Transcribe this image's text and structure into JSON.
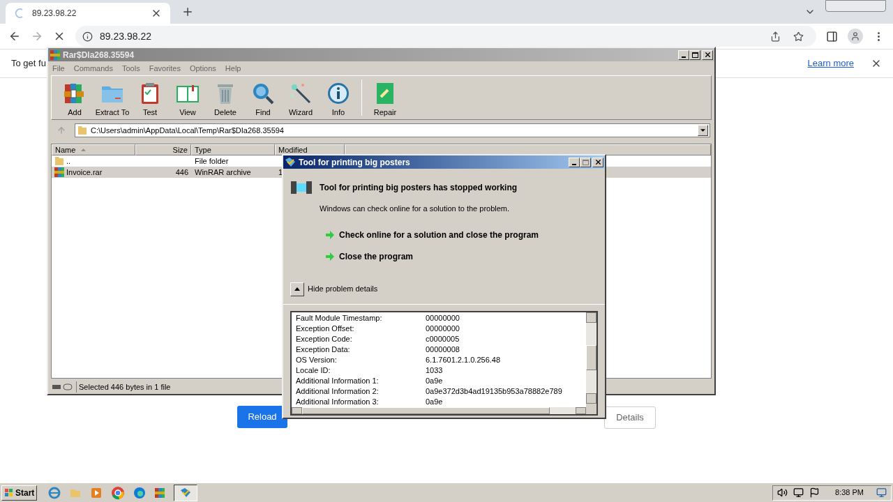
{
  "browser": {
    "tab": {
      "title": "89.23.98.22"
    },
    "address": "89.23.98.22",
    "infobar": {
      "text": "To get fu",
      "link": "Learn more"
    },
    "buttons": {
      "reload": "Reload",
      "details": "Details"
    }
  },
  "winrar": {
    "title": "Rar$DIa268.35594",
    "menu": [
      "File",
      "Commands",
      "Tools",
      "Favorites",
      "Options",
      "Help"
    ],
    "toolbar": [
      {
        "kind": "add",
        "label": "Add"
      },
      {
        "kind": "extract",
        "label": "Extract To"
      },
      {
        "kind": "test",
        "label": "Test"
      },
      {
        "kind": "view",
        "label": "View"
      },
      {
        "kind": "delete",
        "label": "Delete"
      },
      {
        "kind": "find",
        "label": "Find"
      },
      {
        "kind": "wizard",
        "label": "Wizard"
      },
      {
        "kind": "info",
        "label": "Info"
      },
      {
        "kind": "repair",
        "label": "Repair"
      }
    ],
    "path": "C:\\Users\\admin\\AppData\\Local\\Temp\\Rar$DIa268.35594",
    "columns": [
      "Name",
      "Size",
      "Type",
      "Modified"
    ],
    "rows": [
      {
        "kind": "folder",
        "name": "..",
        "size": "",
        "type": "File folder",
        "modified": "",
        "selected": false
      },
      {
        "kind": "archive",
        "name": "Invoice.rar",
        "size": "446",
        "type": "WinRAR archive",
        "modified": "1",
        "selected": true
      }
    ],
    "status": "Selected 446 bytes in 1 file"
  },
  "dialog": {
    "title": "Tool for printing big posters",
    "heading": "Tool for printing big posters has stopped working",
    "subtext": "Windows can check online for a solution to the problem.",
    "options": [
      "Check online for a solution and close the program",
      "Close the program"
    ],
    "toggle": {
      "label": "Hide problem details",
      "expanded": true
    },
    "details": [
      {
        "label": "Fault Module Timestamp:",
        "value": "00000000"
      },
      {
        "label": "Exception Offset:",
        "value": "00000000"
      },
      {
        "label": "Exception Code:",
        "value": "c0000005"
      },
      {
        "label": "Exception Data:",
        "value": "00000008"
      },
      {
        "label": "OS Version:",
        "value": "6.1.7601.2.1.0.256.48"
      },
      {
        "label": "Locale ID:",
        "value": "1033"
      },
      {
        "label": "Additional Information 1:",
        "value": "0a9e"
      },
      {
        "label": "Additional Information 2:",
        "value": "0a9e372d3b4ad19135b953a78882e789"
      },
      {
        "label": "Additional Information 3:",
        "value": "0a9e"
      }
    ]
  },
  "taskbar": {
    "start": "Start",
    "time": "8:38 PM"
  }
}
